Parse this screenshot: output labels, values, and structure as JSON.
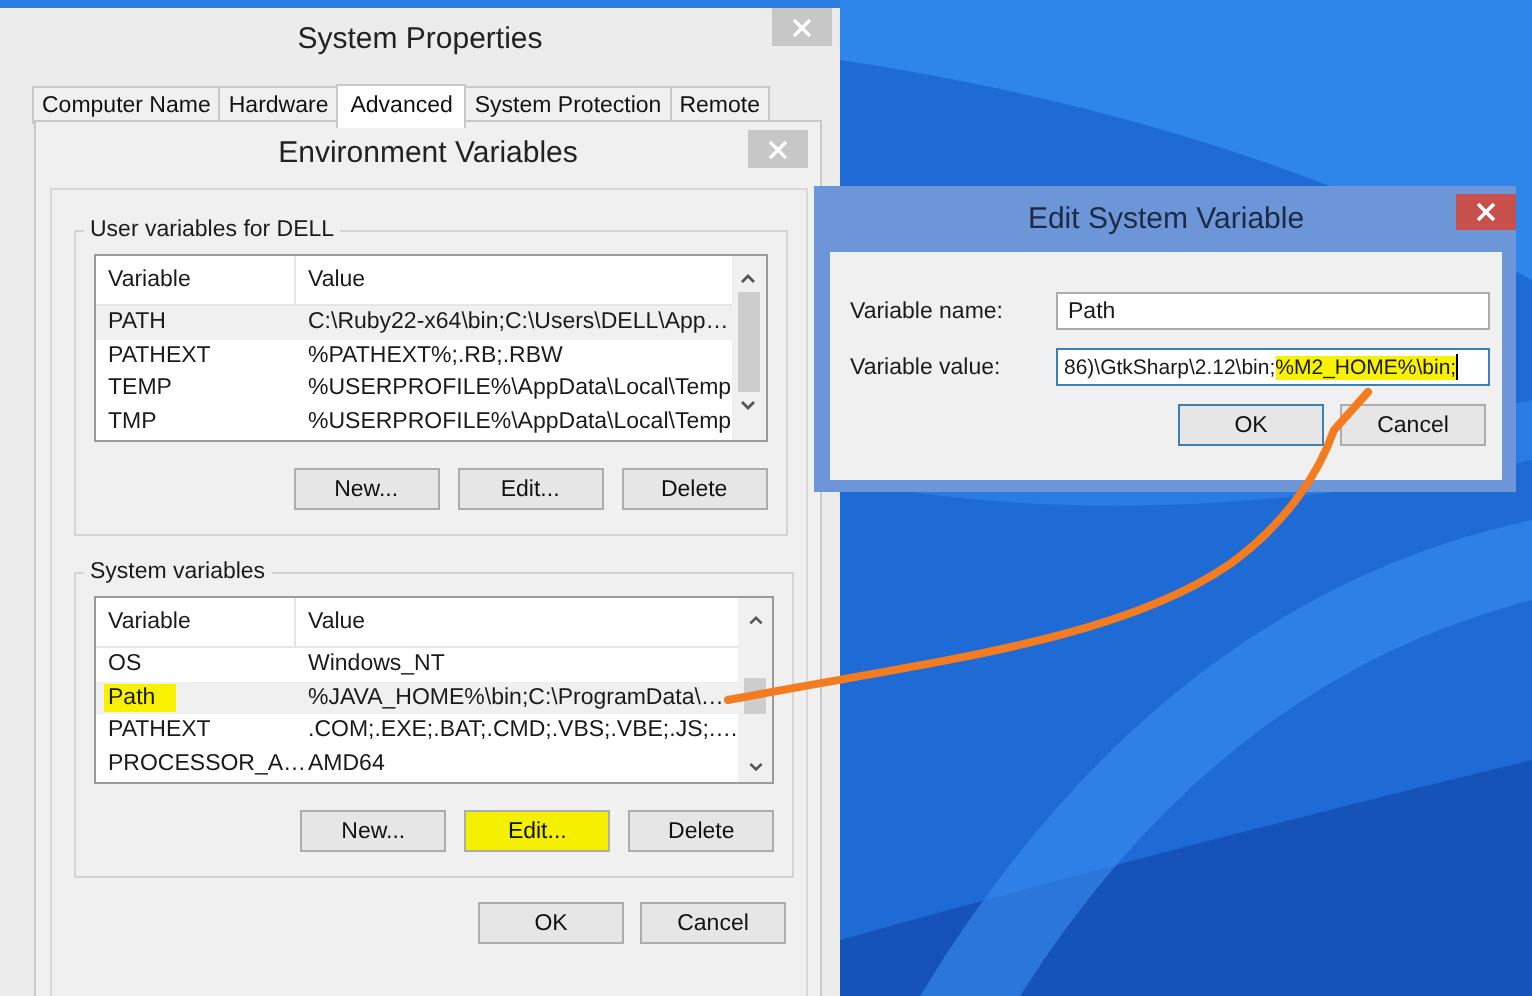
{
  "system_properties": {
    "title": "System Properties",
    "tabs": [
      {
        "label": "Computer Name",
        "selected": false
      },
      {
        "label": "Hardware",
        "selected": false
      },
      {
        "label": "Advanced",
        "selected": true
      },
      {
        "label": "System Protection",
        "selected": false
      },
      {
        "label": "Remote",
        "selected": false
      }
    ]
  },
  "environment_variables": {
    "title": "Environment Variables",
    "groups": [
      {
        "label": "User variables for DELL",
        "columns": [
          "Variable",
          "Value"
        ],
        "rows": [
          {
            "variable": "PATH",
            "value": "C:\\Ruby22-x64\\bin;C:\\Users\\DELL\\App…",
            "selected": true,
            "highlighted": false
          },
          {
            "variable": "PATHEXT",
            "value": "%PATHEXT%;.RB;.RBW",
            "selected": false,
            "highlighted": false
          },
          {
            "variable": "TEMP",
            "value": "%USERPROFILE%\\AppData\\Local\\Temp",
            "selected": false,
            "highlighted": false
          },
          {
            "variable": "TMP",
            "value": "%USERPROFILE%\\AppData\\Local\\Temp",
            "selected": false,
            "highlighted": false
          }
        ],
        "buttons": [
          {
            "label": "New...",
            "highlighted": false
          },
          {
            "label": "Edit...",
            "highlighted": false
          },
          {
            "label": "Delete",
            "highlighted": false
          }
        ]
      },
      {
        "label": "System variables",
        "columns": [
          "Variable",
          "Value"
        ],
        "rows": [
          {
            "variable": "OS",
            "value": "Windows_NT",
            "selected": false,
            "highlighted": false
          },
          {
            "variable": "Path",
            "value": "%JAVA_HOME%\\bin;C:\\ProgramData\\…",
            "selected": true,
            "highlighted": true
          },
          {
            "variable": "PATHEXT",
            "value": ".COM;.EXE;.BAT;.CMD;.VBS;.VBE;.JS;.…",
            "selected": false,
            "highlighted": false
          },
          {
            "variable": "PROCESSOR_A…",
            "value": "AMD64",
            "selected": false,
            "highlighted": false
          }
        ],
        "buttons": [
          {
            "label": "New...",
            "highlighted": false
          },
          {
            "label": "Edit...",
            "highlighted": true
          },
          {
            "label": "Delete",
            "highlighted": false
          }
        ]
      }
    ],
    "buttons": [
      "OK",
      "Cancel"
    ]
  },
  "edit_dialog": {
    "title": "Edit System Variable",
    "name_label": "Variable name:",
    "name_value": "Path",
    "value_label": "Variable value:",
    "value_parts": [
      {
        "text": "86)\\GtkSharp\\2.12\\bin;",
        "highlighted": false
      },
      {
        "text": "%M2_HOME%\\bin;",
        "highlighted": true
      }
    ],
    "buttons": [
      "OK",
      "Cancel"
    ]
  }
}
